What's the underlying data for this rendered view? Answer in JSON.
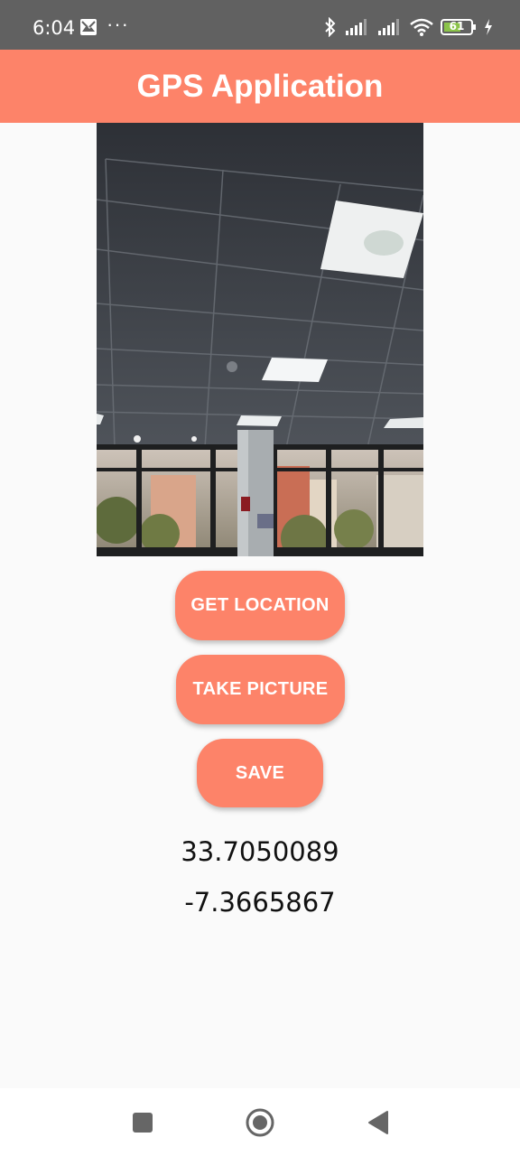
{
  "status_bar": {
    "time": "6:04",
    "more": "···",
    "battery": "61",
    "icons": [
      "photos-icon",
      "bluetooth-icon",
      "signal-icon",
      "signal-icon",
      "wifi-icon",
      "battery-icon",
      "charging-icon"
    ]
  },
  "app_bar": {
    "title": "GPS Application"
  },
  "photo": {
    "description_icon": "camera-photo"
  },
  "buttons": {
    "get_location": "GET LOCATION",
    "take_picture": "TAKE PICTURE",
    "save": "SAVE"
  },
  "location": {
    "latitude": "33.7050089",
    "longitude": "-7.3665867"
  },
  "nav_bar": {
    "icons": [
      "recents-icon",
      "home-icon",
      "back-icon"
    ]
  },
  "colors": {
    "accent": "#fd8369",
    "status_bar": "#616161",
    "background": "#fafafa"
  }
}
